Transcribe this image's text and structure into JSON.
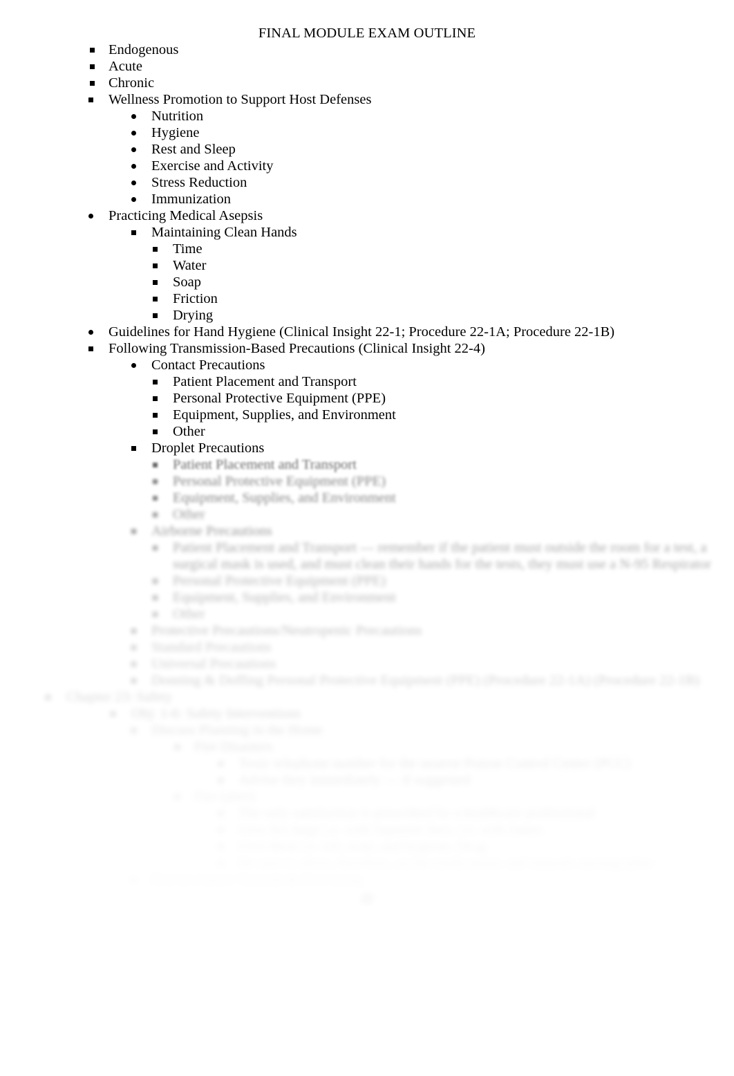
{
  "document": {
    "title": "FINAL MODULE EXAM OUTLINE",
    "page_number": "22"
  },
  "outline": [
    {
      "level": 2,
      "bullet": "square",
      "text": "Endogenous",
      "blur": 0
    },
    {
      "level": 2,
      "bullet": "square",
      "text": "Acute",
      "blur": 0
    },
    {
      "level": 2,
      "bullet": "square",
      "text": "Chronic",
      "blur": 0
    },
    {
      "level": 1,
      "bullet": "square",
      "text": "Wellness Promotion to Support Host Defenses",
      "blur": 0
    },
    {
      "level": 3,
      "bullet": "dot",
      "text": "Nutrition",
      "blur": 0
    },
    {
      "level": 3,
      "bullet": "dot",
      "text": "Hygiene",
      "blur": 0
    },
    {
      "level": 3,
      "bullet": "dot",
      "text": "Rest and Sleep",
      "blur": 0
    },
    {
      "level": 3,
      "bullet": "dot",
      "text": "Exercise and Activity",
      "blur": 0
    },
    {
      "level": 3,
      "bullet": "dot",
      "text": "Stress Reduction",
      "blur": 0
    },
    {
      "level": 3,
      "bullet": "dot",
      "text": "Immunization",
      "blur": 0
    },
    {
      "level": 1,
      "bullet": "dot",
      "text": "Practicing Medical Asepsis",
      "blur": 0
    },
    {
      "level": 6,
      "bullet": "square",
      "text": "Maintaining Clean Hands",
      "blur": 0
    },
    {
      "level": 4,
      "bullet": "square",
      "text": "Time",
      "blur": 0
    },
    {
      "level": 4,
      "bullet": "square",
      "text": "Water",
      "blur": 0
    },
    {
      "level": 4,
      "bullet": "square",
      "text": "Soap",
      "blur": 0
    },
    {
      "level": 4,
      "bullet": "square",
      "text": "Friction",
      "blur": 0
    },
    {
      "level": 4,
      "bullet": "square",
      "text": "Drying",
      "blur": 0
    },
    {
      "level": 1,
      "bullet": "dot",
      "text": "Guidelines for Hand Hygiene (Clinical Insight 22-1; Procedure 22-1A; Procedure 22-1B)",
      "blur": 0
    },
    {
      "level": 1,
      "bullet": "square",
      "text": "Following Transmission-Based Precautions (Clinical Insight 22-4)",
      "blur": 0
    },
    {
      "level": 3,
      "bullet": "dot",
      "text": "Contact Precautions",
      "blur": 0
    },
    {
      "level": 4,
      "bullet": "square",
      "text": "Patient Placement and Transport",
      "blur": 0
    },
    {
      "level": 4,
      "bullet": "square",
      "text": "Personal Protective Equipment (PPE)",
      "blur": 0
    },
    {
      "level": 4,
      "bullet": "square",
      "text": "Equipment, Supplies, and Environment",
      "blur": 0
    },
    {
      "level": 4,
      "bullet": "square",
      "text": "Other",
      "blur": 0
    },
    {
      "level": 3,
      "bullet": "square",
      "text": "Droplet Precautions",
      "blur": 0
    },
    {
      "level": 4,
      "bullet": "square",
      "text": "Patient Placement and Transport",
      "blur": 1
    },
    {
      "level": 4,
      "bullet": "square",
      "text": "Personal Protective Equipment (PPE)",
      "blur": 2
    },
    {
      "level": 4,
      "bullet": "square",
      "text": "Equipment, Supplies, and Environment",
      "blur": 2
    },
    {
      "level": 4,
      "bullet": "square",
      "text": "Other",
      "blur": 3
    },
    {
      "level": 3,
      "bullet": "square",
      "text": "Airborne Precautions",
      "blur": 3
    },
    {
      "level": 4,
      "bullet": "square",
      "text": "Patient Placement and Transport — remember if the patient must outside the room for a test, a surgical mask is used, and must clean their hands for the tests, they must use a N-95 Respirator",
      "blur": 4,
      "wrap": true
    },
    {
      "level": 4,
      "bullet": "square",
      "text": "Personal Protective Equipment (PPE)",
      "blur": 5
    },
    {
      "level": 4,
      "bullet": "square",
      "text": "Equipment, Supplies, and Environment",
      "blur": 5
    },
    {
      "level": 4,
      "bullet": "square",
      "text": "Other",
      "blur": 6
    },
    {
      "level": 3,
      "bullet": "square",
      "text": "Protective Precautions/Neutropenic Precautions",
      "blur": 6
    },
    {
      "level": 3,
      "bullet": "square",
      "text": "Standard Precautions",
      "blur": 7
    },
    {
      "level": 3,
      "bullet": "square",
      "text": "Universal Precautions",
      "blur": 7
    },
    {
      "level": 3,
      "bullet": "square",
      "text": "Donning & Doffing Personal Protective Equipment (PPE) (Procedure 22-1A) (Procedure 22-1B)",
      "blur": 7
    },
    {
      "level": 7,
      "bullet": "square",
      "text": "Chapter 23: Safety",
      "blur": 8
    },
    {
      "level": 8,
      "bullet": "square",
      "text": "Obj: 1-6: Safety Interventions",
      "blur": 8
    },
    {
      "level": 9,
      "bullet": "square",
      "text": "Discuss Planning in the Home",
      "blur": 9
    },
    {
      "level": 10,
      "bullet": "square",
      "text": "Fire Disasters",
      "blur": 9
    },
    {
      "level": 11,
      "bullet": "square",
      "text": "Toxic telephone number for the nearest Poison Control Center (PCC)",
      "blur": 10
    },
    {
      "level": 11,
      "bullet": "square",
      "text": "Advise they immediately — if suggested",
      "blur": 10
    },
    {
      "level": 10,
      "bullet": "square",
      "text": "Fire (alert)",
      "blur": 11
    },
    {
      "level": 11,
      "bullet": "square",
      "text": "The only satisfaction is prescribed by a healthcare professional",
      "blur": 11
    },
    {
      "level": 11,
      "bullet": "square",
      "text": "Give fire huge i.e. with Vaporize fires, i.e. with fumes",
      "blur": 12
    },
    {
      "level": 11,
      "bullet": "square",
      "text": "Give them i.e. left, nose, and hygiene, Drug",
      "blur": 12
    },
    {
      "level": 11,
      "bullet": "square",
      "text": "Be sure to allow, therefore, on the medications and naturals nursing labor",
      "blur": 13
    },
    {
      "level": 9,
      "bullet": "square",
      "text": "Discuss Injury Hazards & Preventing",
      "blur": 13
    }
  ]
}
